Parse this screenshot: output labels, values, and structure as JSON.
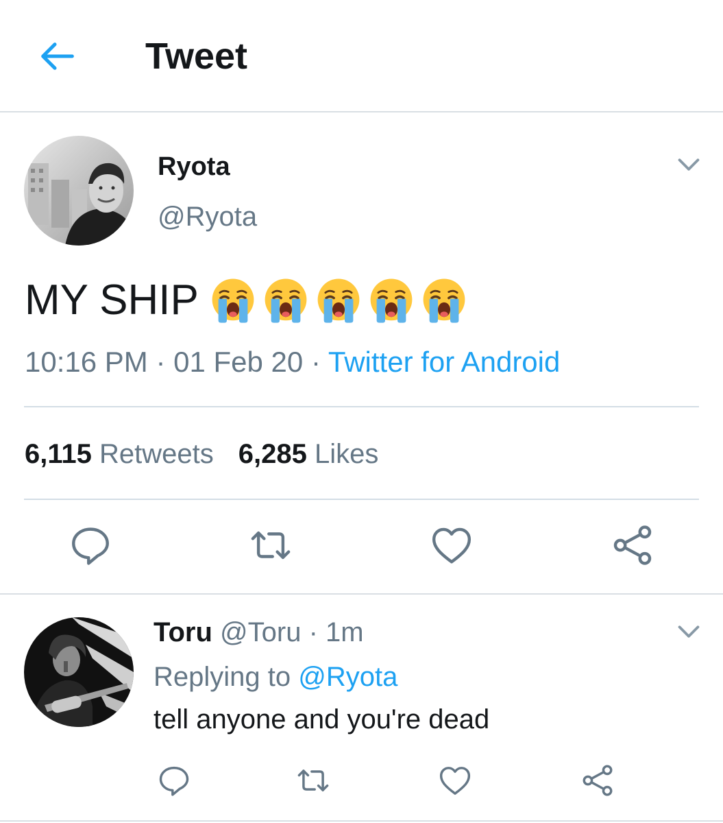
{
  "header": {
    "title": "Tweet"
  },
  "tweet": {
    "author_name": "Ryota",
    "author_handle": "@Ryota",
    "text": "MY SHIP",
    "emojis": [
      "loudly-crying-face",
      "loudly-crying-face",
      "loudly-crying-face",
      "loudly-crying-face",
      "loudly-crying-face"
    ],
    "time": "10:16 PM",
    "date": "01 Feb 20",
    "separator": "·",
    "source": "Twitter for Android",
    "retweets_count": "6,115",
    "retweets_label": "Retweets",
    "likes_count": "6,285",
    "likes_label": "Likes"
  },
  "reply": {
    "author_name": "Toru",
    "author_handle": "@Toru",
    "separator": "·",
    "time": "1m",
    "replying_to_label": "Replying to",
    "replying_to_handle": "@Ryota",
    "text": "tell anyone and you're dead"
  },
  "icons": {
    "back": "arrow-left-icon",
    "menu": "chevron-down-icon",
    "reply": "reply-icon",
    "retweet": "retweet-icon",
    "like": "heart-icon",
    "share": "share-icon"
  },
  "colors": {
    "accent": "#1da1f2",
    "muted": "#657786",
    "text": "#14171a",
    "divider": "#d9dfe4",
    "icon": "#657786"
  }
}
